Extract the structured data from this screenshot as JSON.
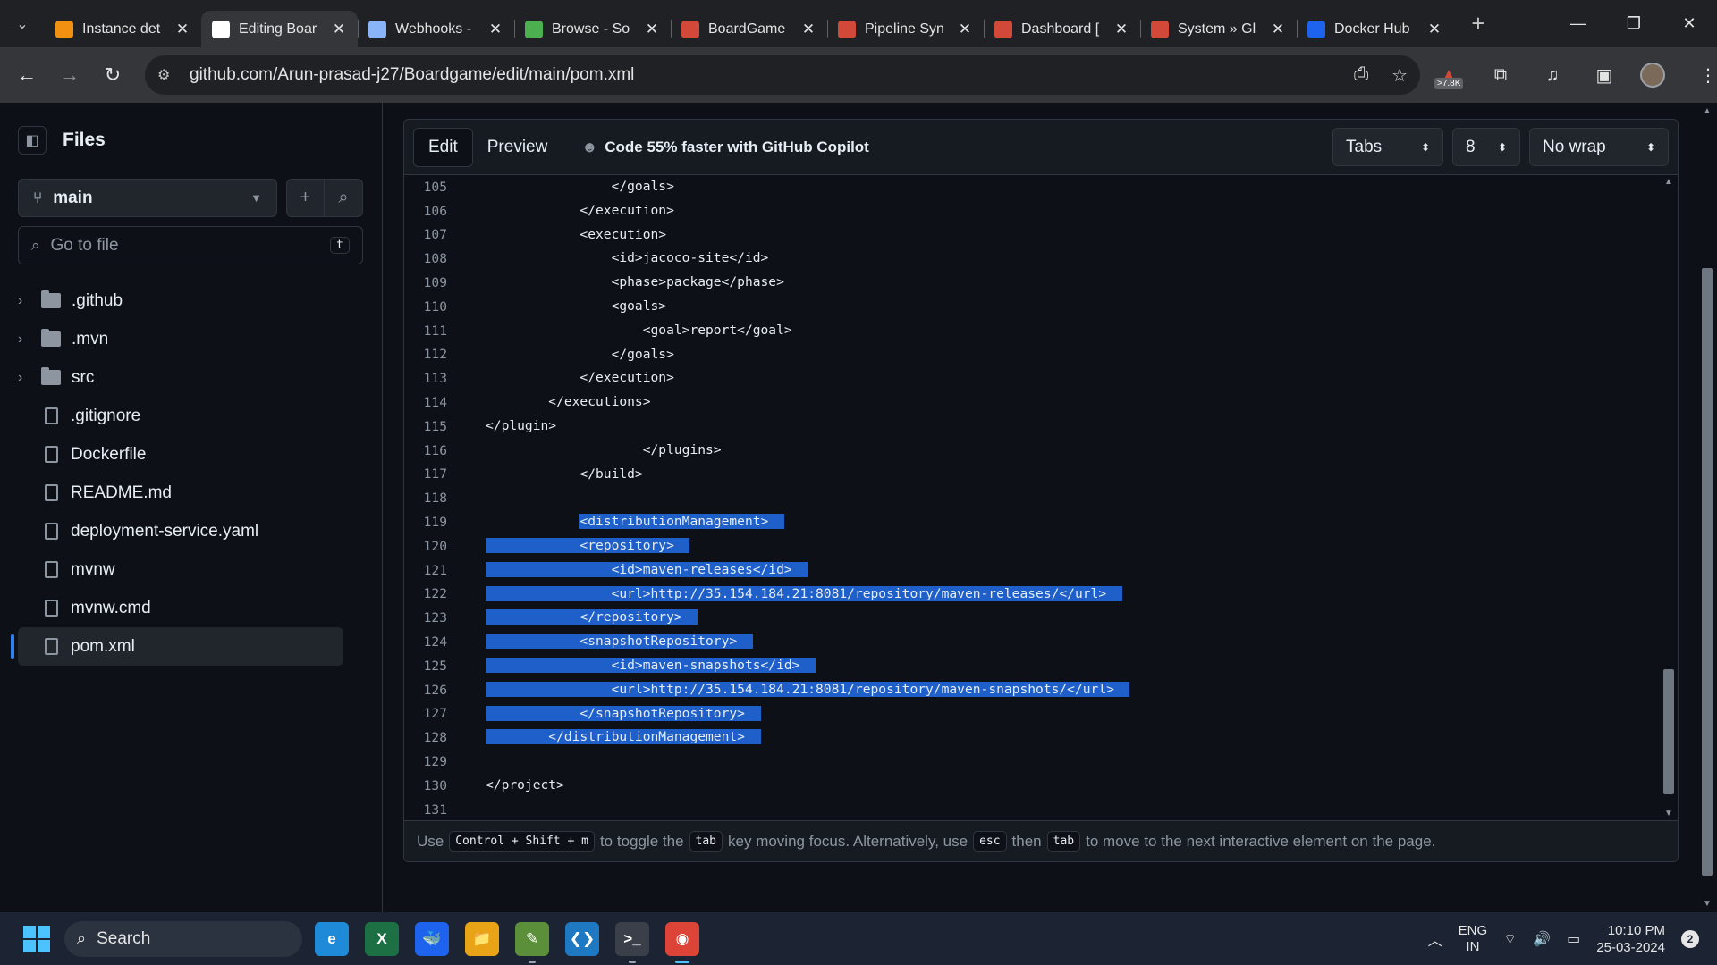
{
  "tabs": [
    {
      "title": "Instance det",
      "icon": "aws-icon",
      "color": "#f29111"
    },
    {
      "title": "Editing Boar",
      "icon": "github-icon",
      "color": "#ffffff",
      "active": true
    },
    {
      "title": "Webhooks -",
      "icon": "webhook-icon",
      "color": "#8ab4f8"
    },
    {
      "title": "Browse - So",
      "icon": "sonar-icon",
      "color": "#4caf50"
    },
    {
      "title": "BoardGame",
      "icon": "jenkins-icon",
      "color": "#d24939"
    },
    {
      "title": "Pipeline Syn",
      "icon": "jenkins-icon",
      "color": "#d24939"
    },
    {
      "title": "Dashboard [",
      "icon": "jenkins-icon",
      "color": "#d24939"
    },
    {
      "title": "System » Gl",
      "icon": "jenkins-icon",
      "color": "#d24939"
    },
    {
      "title": "Docker Hub",
      "icon": "docker-icon",
      "color": "#1d63ed"
    }
  ],
  "address": {
    "url": "github.com/Arun-prasad-j27/Boardgame/edit/main/pom.xml"
  },
  "extension_badge": ">7.8K",
  "sidebar": {
    "title": "Files",
    "branch": "main",
    "goto_placeholder": "Go to file",
    "goto_shortcut": "t",
    "items": [
      {
        "name": ".github",
        "type": "folder"
      },
      {
        "name": ".mvn",
        "type": "folder"
      },
      {
        "name": "src",
        "type": "folder"
      },
      {
        "name": ".gitignore",
        "type": "file"
      },
      {
        "name": "Dockerfile",
        "type": "file"
      },
      {
        "name": "README.md",
        "type": "file"
      },
      {
        "name": "deployment-service.yaml",
        "type": "file"
      },
      {
        "name": "mvnw",
        "type": "file"
      },
      {
        "name": "mvnw.cmd",
        "type": "file"
      },
      {
        "name": "pom.xml",
        "type": "file",
        "selected": true
      }
    ]
  },
  "editor": {
    "edit_label": "Edit",
    "preview_label": "Preview",
    "copilot_label": "Code 55% faster with GitHub Copilot",
    "indent_mode": "Tabs",
    "indent_size": "8",
    "wrap_mode": "No wrap",
    "selection_color": "#1f5fc9",
    "lines": [
      {
        "n": "105",
        "text": "                </goals>",
        "sel": false
      },
      {
        "n": "106",
        "text": "            </execution>",
        "sel": false
      },
      {
        "n": "107",
        "text": "            <execution>",
        "sel": false
      },
      {
        "n": "108",
        "text": "                <id>jacoco-site</id>",
        "sel": false
      },
      {
        "n": "109",
        "text": "                <phase>package</phase>",
        "sel": false
      },
      {
        "n": "110",
        "text": "                <goals>",
        "sel": false
      },
      {
        "n": "111",
        "text": "                    <goal>report</goal>",
        "sel": false
      },
      {
        "n": "112",
        "text": "                </goals>",
        "sel": false
      },
      {
        "n": "113",
        "text": "            </execution>",
        "sel": false
      },
      {
        "n": "114",
        "text": "        </executions>",
        "sel": false
      },
      {
        "n": "115",
        "text": "</plugin>",
        "sel": false
      },
      {
        "n": "116",
        "text": "                    </plugins>",
        "sel": false
      },
      {
        "n": "117",
        "text": "            </build>",
        "sel": false
      },
      {
        "n": "118",
        "text": "",
        "sel": false
      },
      {
        "n": "119",
        "text": "            <distributionManagement>",
        "sel": "partial"
      },
      {
        "n": "120",
        "text": "            <repository>",
        "sel": true
      },
      {
        "n": "121",
        "text": "                <id>maven-releases</id>",
        "sel": true
      },
      {
        "n": "122",
        "text": "                <url>http://35.154.184.21:8081/repository/maven-releases/</url>",
        "sel": true
      },
      {
        "n": "123",
        "text": "            </repository>",
        "sel": true
      },
      {
        "n": "124",
        "text": "            <snapshotRepository>",
        "sel": true
      },
      {
        "n": "125",
        "text": "                <id>maven-snapshots</id>",
        "sel": true
      },
      {
        "n": "126",
        "text": "                <url>http://35.154.184.21:8081/repository/maven-snapshots/</url>",
        "sel": true
      },
      {
        "n": "127",
        "text": "            </snapshotRepository>",
        "sel": true
      },
      {
        "n": "128",
        "text": "        </distributionManagement>",
        "sel": true
      },
      {
        "n": "129",
        "text": "",
        "sel": false
      },
      {
        "n": "130",
        "text": "</project>",
        "sel": false
      },
      {
        "n": "131",
        "text": "",
        "sel": false
      }
    ],
    "footer": {
      "t1": "Use",
      "k1": "Control + Shift + m",
      "t2": "to toggle the",
      "k2": "tab",
      "t3": "key moving focus. Alternatively, use",
      "k3": "esc",
      "t4": "then",
      "k4": "tab",
      "t5": "to move to the next interactive element on the page."
    }
  },
  "taskbar": {
    "search_label": "Search",
    "apps": [
      {
        "name": "edge-icon",
        "glyph": "e",
        "color": "#1f8bd8"
      },
      {
        "name": "excel-icon",
        "glyph": "X",
        "color": "#1d7044"
      },
      {
        "name": "docker-desktop-icon",
        "glyph": "🐳",
        "color": "#1d63ed"
      },
      {
        "name": "file-explorer-icon",
        "glyph": "📁",
        "color": "#e8a317"
      },
      {
        "name": "notepad-icon",
        "glyph": "✎",
        "color": "#5c8f3a"
      },
      {
        "name": "vscode-icon",
        "glyph": "❮❯",
        "color": "#1e78c2"
      },
      {
        "name": "terminal-icon",
        "glyph": ">_",
        "color": "#3a3f4a"
      },
      {
        "name": "chrome-icon",
        "glyph": "◉",
        "color": "#db4437"
      }
    ],
    "lang_top": "ENG",
    "lang_bottom": "IN",
    "time": "10:10 PM",
    "date": "25-03-2024",
    "notifications": "2"
  }
}
